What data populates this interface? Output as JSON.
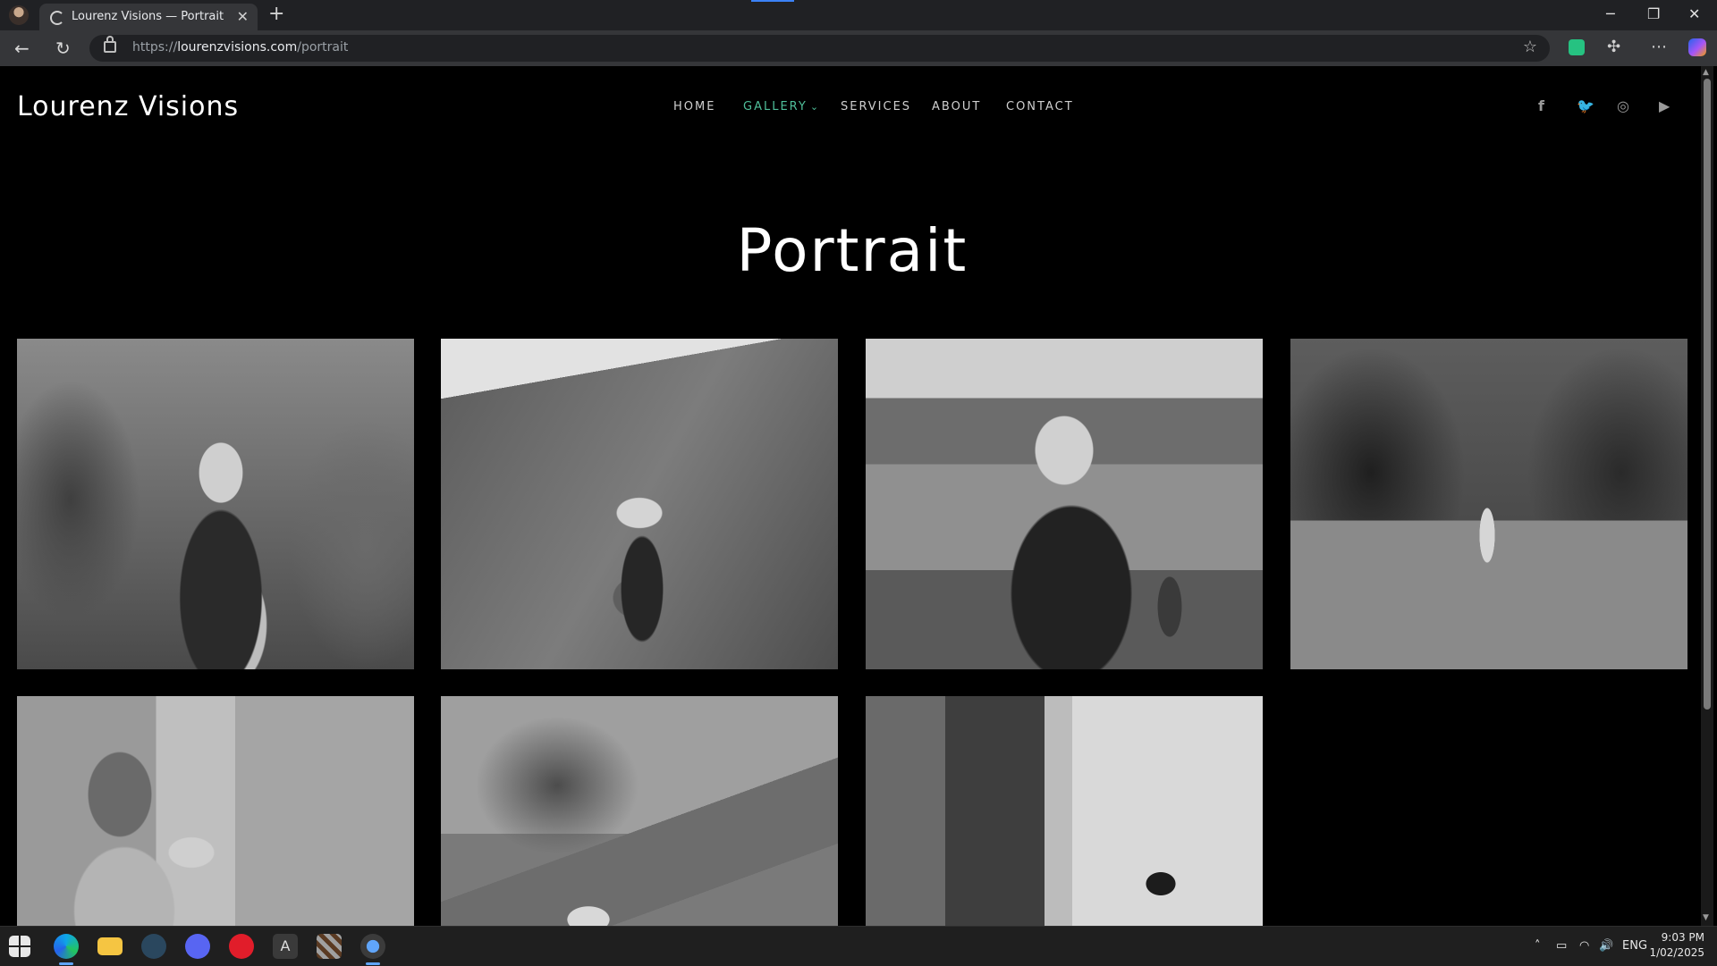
{
  "browser": {
    "tab_title": "Lourenz Visions — Portrait",
    "url_scheme": "https://",
    "url_domain": "lourenzvisions.com",
    "url_path": "/portrait",
    "icons": [
      "profile-avatar",
      "tab-favicon",
      "close-icon",
      "plus-icon",
      "minimize-icon",
      "restore-icon",
      "close-window-icon",
      "back-icon",
      "refresh-icon",
      "lock-icon",
      "star-icon",
      "extension-icon",
      "puzzle-icon",
      "more-icon",
      "copilot-icon"
    ]
  },
  "site": {
    "logo": "Lourenz Visions",
    "nav": [
      {
        "label": "HOME",
        "active": false
      },
      {
        "label": "GALLERY",
        "active": true,
        "dropdown": true
      },
      {
        "label": "SERVICES",
        "active": false
      },
      {
        "label": "ABOUT",
        "active": false
      },
      {
        "label": "CONTACT",
        "active": false
      }
    ],
    "social": [
      "facebook-icon",
      "twitter-icon",
      "instagram-icon",
      "youtube-icon"
    ],
    "page_title": "Portrait",
    "accent_color": "#4fbf9a",
    "gallery": [
      {
        "subject": "woman-portrait-garden"
      },
      {
        "subject": "child-with-hats-hillside"
      },
      {
        "subject": "hat-vendor-back-view"
      },
      {
        "subject": "garden-path-walkers"
      },
      {
        "subject": "man-in-cafe"
      },
      {
        "subject": "tree-and-ball"
      },
      {
        "subject": "cafe-interior-table-numbers"
      }
    ]
  },
  "taskbar": {
    "apps": [
      "windows-start-icon",
      "edge-icon",
      "file-explorer-icon",
      "steam-icon",
      "discord-icon",
      "app-red-icon",
      "app-a-icon",
      "minecraft-icon",
      "app-bird-icon"
    ],
    "language": "ENG",
    "time": "9:03 PM",
    "date": "1/02/2025"
  }
}
